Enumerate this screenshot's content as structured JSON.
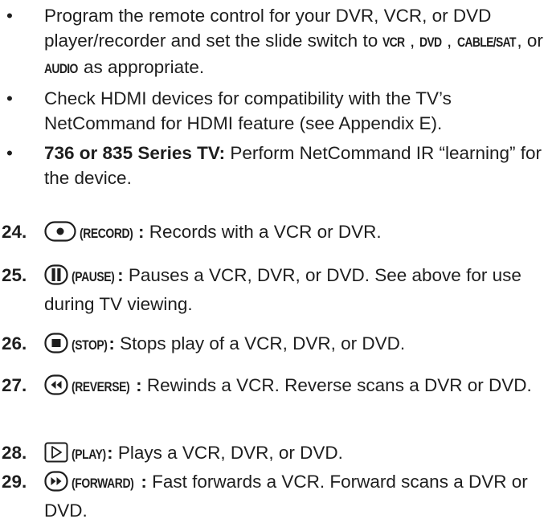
{
  "bullets": [
    {
      "parts": [
        "Program the remote control for your DVR, VCR, or DVD player/recorder and set the slide switch to ",
        "VCR",
        ", ",
        "DVD",
        ", ",
        "CABLE/SAT",
        ", or ",
        "AUDIO",
        " as appropriate."
      ]
    },
    {
      "text": "Check HDMI devices for compatibility with the TV’s NetCommand for HDMI feature (see Appendix E)."
    },
    {
      "bold": "736 or 835 Series TV:",
      "text": " Perform NetCommand IR “learning” for the device."
    }
  ],
  "items": [
    {
      "num": "24.",
      "icon": "record-button-icon",
      "name": "(RECORD)",
      "desc": " Records with a VCR or DVR."
    },
    {
      "num": "25.",
      "icon": "pause-button-icon",
      "name": "(PAUSE)",
      "desc": " Pauses a VCR, DVR, or DVD.  See above for use during TV viewing."
    },
    {
      "num": "26.",
      "icon": "stop-button-icon",
      "name": "(STOP)",
      "desc": " Stops play of a VCR, DVR, or DVD."
    },
    {
      "num": "27.",
      "icon": "reverse-button-icon",
      "name": "(REVERSE)",
      "desc": " Rewinds a VCR.  Reverse scans a DVR or DVD."
    },
    {
      "num": "28.",
      "icon": "play-button-icon",
      "name": "(PLAY)",
      "desc": " Plays a VCR, DVR, or DVD."
    },
    {
      "num": "29.",
      "icon": "forward-button-icon",
      "name": "(FORWARD)",
      "desc": " Fast forwards a VCR.  Forward scans a DVR or DVD."
    }
  ],
  "bullet_symbol": "•",
  "colon": ":"
}
